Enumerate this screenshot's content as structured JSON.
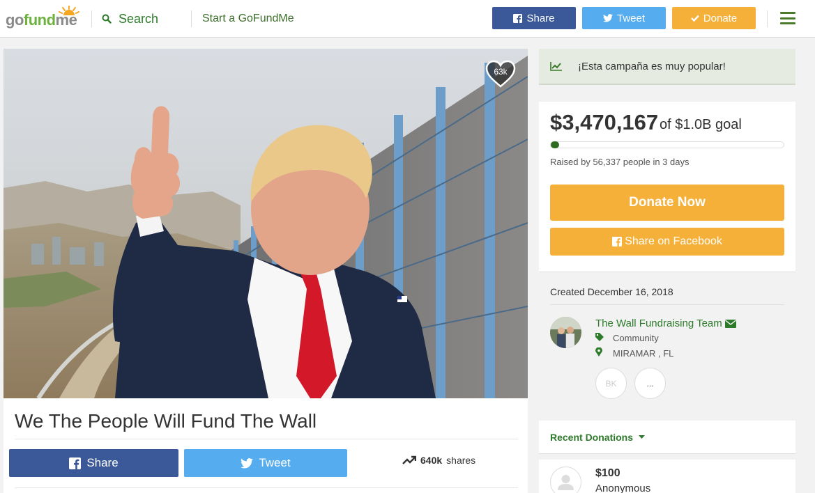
{
  "header": {
    "logo_go": "go",
    "logo_fund": "fund",
    "logo_me": "me",
    "search_label": "Search",
    "start_label": "Start a GoFundMe",
    "share_label": "Share",
    "tweet_label": "Tweet",
    "donate_label": "Donate"
  },
  "hero": {
    "heart_count": "63k"
  },
  "campaign": {
    "title": "We The People Will Fund The Wall",
    "share_label": "Share",
    "tweet_label": "Tweet",
    "shares_count": "640k",
    "shares_label": "shares"
  },
  "sidebar": {
    "popular_text": "¡Esta campaña es muy popular!",
    "raised_amount": "$3,470,167",
    "goal_text": "of $1.0B goal",
    "progress_fraction": 0.0035,
    "raised_by": "Raised by 56,337 people in 3 days",
    "donate_now_label": "Donate Now",
    "share_facebook_label": "Share on Facebook",
    "created": "Created December 16, 2018",
    "organizer_name": "The Wall Fundraising Team",
    "category": "Community",
    "location": "MIRAMAR , FL",
    "initials": "BK",
    "more_label": "...",
    "recent_label": "Recent Donations",
    "donation_amount": "$100",
    "donation_name": "Anonymous"
  },
  "colors": {
    "brand_green": "#6cb33e",
    "facebook": "#3b5998",
    "twitter": "#55acee",
    "donate_orange": "#f5b03a"
  }
}
